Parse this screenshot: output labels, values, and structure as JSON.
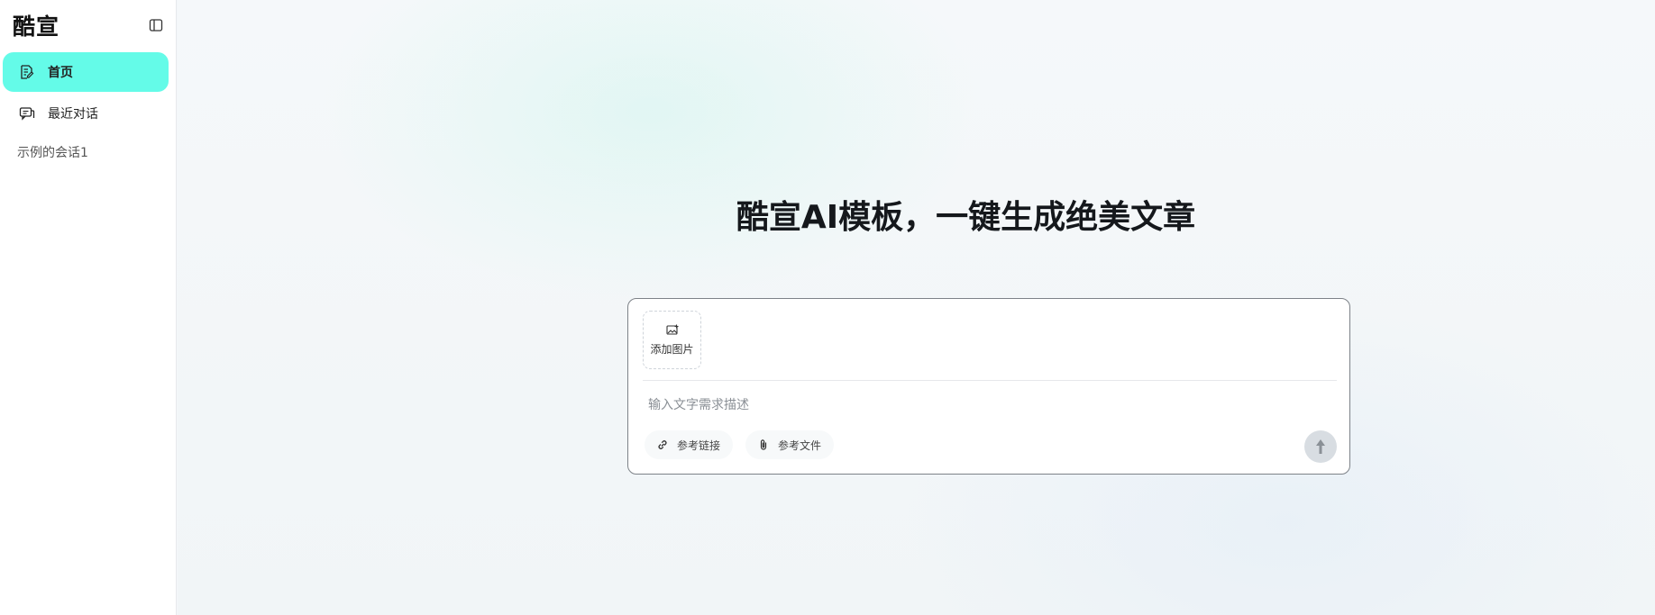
{
  "sidebar": {
    "brand": "酷宣",
    "toggle_icon": "sidebar-panel-icon",
    "nav": [
      {
        "label": "首页",
        "icon": "document-edit-icon",
        "active": true
      },
      {
        "label": "最近对话",
        "icon": "chat-bubbles-icon",
        "active": false
      }
    ],
    "sessions": [
      {
        "label": "示例的会话1"
      }
    ]
  },
  "main": {
    "headline": "酷宣AI模板，一键生成绝美文章",
    "composer": {
      "add_image_label": "添加图片",
      "add_image_icon": "image-add-icon",
      "input_value": "",
      "input_placeholder": "输入文字需求描述",
      "chips": [
        {
          "label": "参考链接",
          "icon": "link-icon"
        },
        {
          "label": "参考文件",
          "icon": "paperclip-icon"
        }
      ],
      "send_icon": "arrow-up-icon"
    }
  },
  "colors": {
    "active_nav": "#64fbe8",
    "send_button": "#d8dde2",
    "composer_border": "#7d8288"
  }
}
